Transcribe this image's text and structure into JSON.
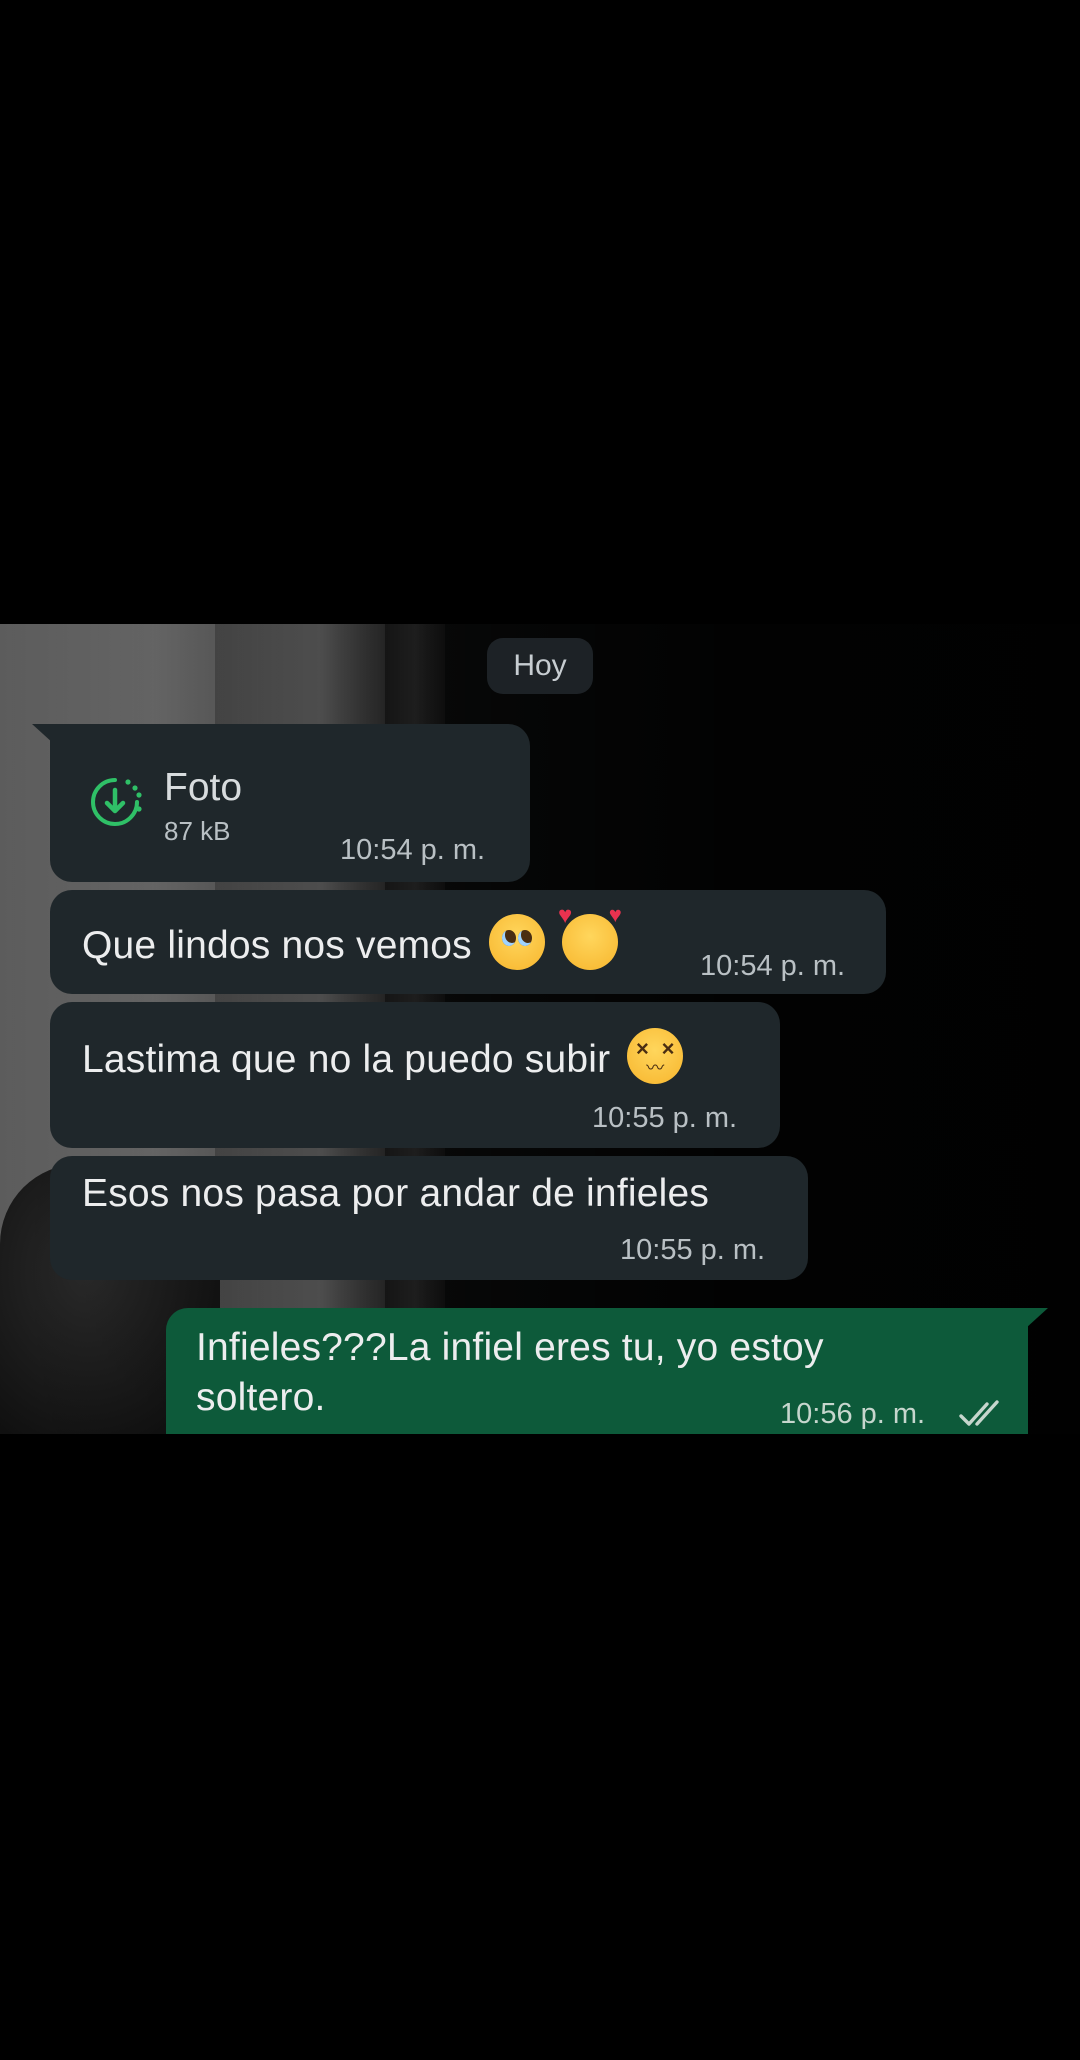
{
  "date_divider": "Hoy",
  "messages": [
    {
      "direction": "incoming",
      "type": "photo",
      "title": "Foto",
      "size": "87 kB",
      "time": "10:54 p. m."
    },
    {
      "direction": "incoming",
      "text": "Que lindos nos vemos",
      "emojis": [
        "pleading-face-emoji",
        "smiling-face-with-hearts-emoji"
      ],
      "time": "10:54 p. m."
    },
    {
      "direction": "incoming",
      "text": "Lastima que no la puedo subir",
      "emojis": [
        "confounded-face-emoji"
      ],
      "time": "10:55 p. m."
    },
    {
      "direction": "incoming",
      "text": "Esos nos pasa por andar de infieles",
      "time": "10:55 p. m."
    },
    {
      "direction": "outgoing",
      "text_line1": "Infieles???La infiel eres tu, yo estoy",
      "text_line2": "soltero.",
      "time": "10:56 p. m.",
      "status_icon": "double-check-icon"
    }
  ],
  "colors": {
    "incoming_bubble": "#1f272b",
    "outgoing_bubble": "#0d5a3a",
    "download_accent": "#2fc067",
    "date_chip": "#1d2226"
  }
}
